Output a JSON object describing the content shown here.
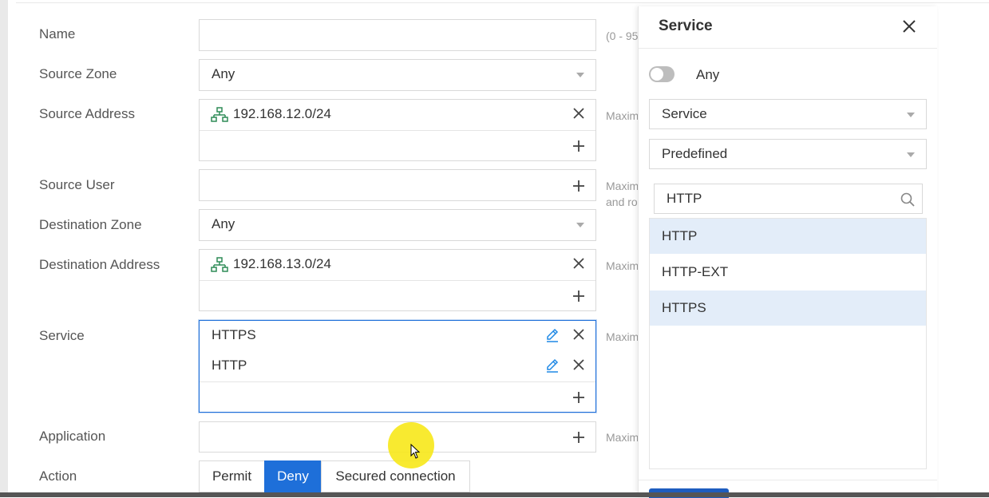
{
  "form": {
    "name": {
      "label": "Name",
      "value": "",
      "hint": "(0 - 95"
    },
    "source_zone": {
      "label": "Source Zone",
      "value": "Any"
    },
    "source_address": {
      "label": "Source Address",
      "items": [
        "192.168.12.0/24"
      ],
      "hint": "Maxim"
    },
    "source_user": {
      "label": "Source User",
      "hint_line1": "Maxim",
      "hint_line2": "and ro"
    },
    "destination_zone": {
      "label": "Destination Zone",
      "value": "Any"
    },
    "destination_address": {
      "label": "Destination Address",
      "items": [
        "192.168.13.0/24"
      ],
      "hint": "Maxim"
    },
    "service": {
      "label": "Service",
      "items": [
        "HTTPS",
        "HTTP"
      ],
      "hint": "Maxim"
    },
    "application": {
      "label": "Application",
      "hint": "Maxim"
    },
    "action": {
      "label": "Action",
      "options": [
        "Permit",
        "Deny",
        "Secured connection"
      ],
      "selected": "Deny"
    }
  },
  "drawer": {
    "title": "Service",
    "any_toggle": {
      "label": "Any",
      "on": false
    },
    "type_select": "Service",
    "category_select": "Predefined",
    "search_value": "HTTP",
    "results": [
      {
        "label": "HTTP",
        "selected": true
      },
      {
        "label": "HTTP-EXT",
        "selected": false
      },
      {
        "label": "HTTPS",
        "selected": true
      }
    ]
  },
  "colors": {
    "accent": "#1e6fd9",
    "selected_row": "#e3edf9",
    "network_icon": "#2e8b57",
    "edit_icon": "#1e88e5"
  },
  "icons": [
    "network-object-icon",
    "close-icon",
    "plus-icon",
    "edit-icon",
    "chevron-down-icon",
    "search-icon"
  ]
}
